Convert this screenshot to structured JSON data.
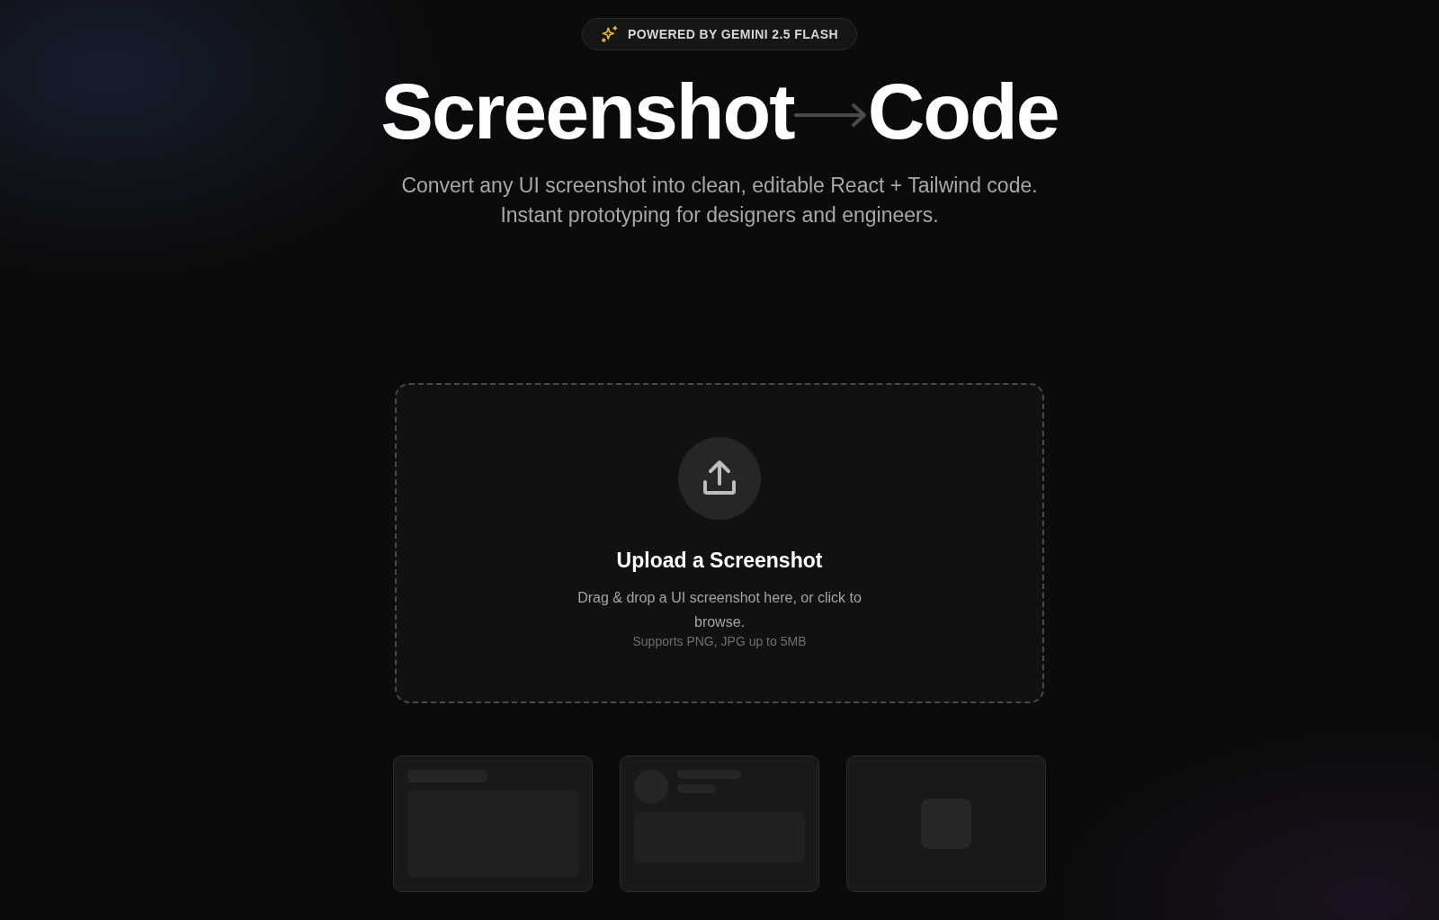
{
  "badge": {
    "text": "POWERED BY GEMINI 2.5 FLASH"
  },
  "hero": {
    "title_left": "Screenshot",
    "title_right": "Code",
    "subtitle_lines": [
      "Convert any UI screenshot into clean, editable React + Tailwind code.",
      "Instant prototyping for designers and engineers."
    ]
  },
  "dropzone": {
    "heading": "Upload a Screenshot",
    "description": "Drag & drop a UI screenshot here, or click to browse.",
    "hint": "Supports PNG, JPG up to 5MB"
  },
  "preview_cards": [
    {
      "kind": "article"
    },
    {
      "kind": "profile"
    },
    {
      "kind": "media"
    }
  ]
}
